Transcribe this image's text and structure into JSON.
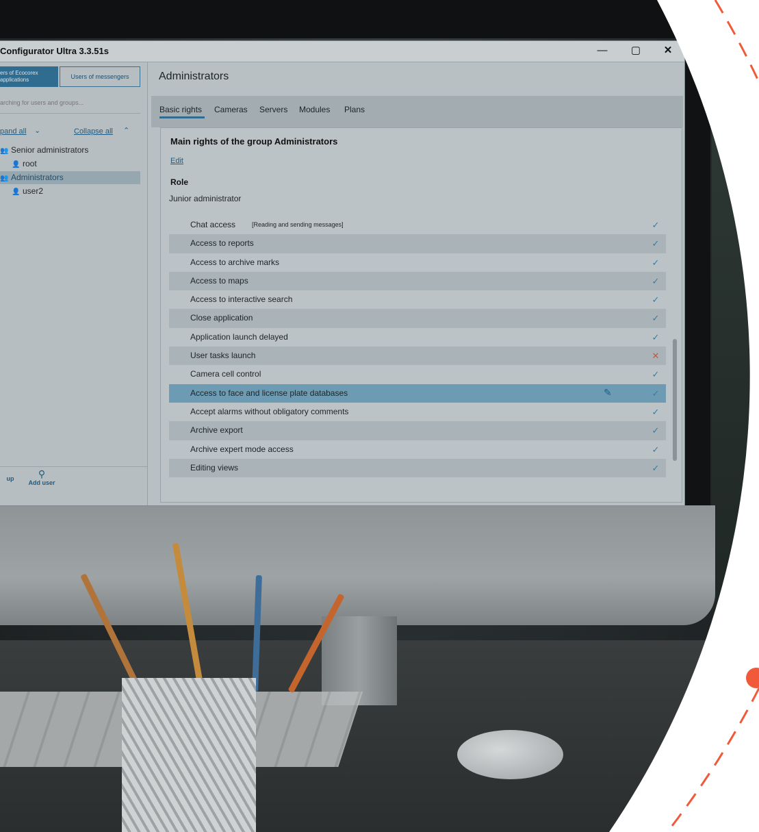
{
  "window": {
    "title": "Configurator Ultra 3.3.51s",
    "minimize_icon": "minimize-icon",
    "maximize_icon": "maximize-icon",
    "close_icon": "close-icon"
  },
  "sidebar": {
    "tabs": {
      "apps_label": "ers of Ecocorex\napplications",
      "messengers_label": "Users of messengers"
    },
    "search_placeholder": "arching for users and groups...",
    "expand_all": "pand all",
    "collapse_all": "Collapse all",
    "tree": [
      {
        "label": "Senior administrators",
        "icon": "group-icon"
      },
      {
        "label": "root",
        "icon": "user-icon"
      },
      {
        "label": "Administrators",
        "icon": "group-icon",
        "selected": true
      },
      {
        "label": "user2",
        "icon": "user-icon"
      }
    ],
    "footer": {
      "add_group": "up",
      "add_user": "Add user"
    }
  },
  "main": {
    "title": "Administrators",
    "tabs": [
      "Basic rights",
      "Cameras",
      "Servers",
      "Modules",
      "Plans"
    ],
    "active_tab": "Basic rights",
    "section_title": "Main rights of the group Administrators",
    "edit_link": "Edit",
    "role_label": "Role",
    "role_value": "Junior administrator",
    "rights": [
      {
        "name": "Chat access",
        "note": "[Reading and sending messages]",
        "status": "allowed"
      },
      {
        "name": "Access to reports",
        "status": "allowed"
      },
      {
        "name": "Access to archive marks",
        "status": "allowed"
      },
      {
        "name": "Access to maps",
        "status": "allowed"
      },
      {
        "name": "Access to interactive search",
        "status": "allowed"
      },
      {
        "name": "Close application",
        "status": "allowed"
      },
      {
        "name": "Application launch delayed",
        "status": "allowed"
      },
      {
        "name": "User tasks launch",
        "status": "denied"
      },
      {
        "name": "Camera cell control",
        "status": "allowed"
      },
      {
        "name": "Access to face and license plate databases",
        "status": "allowed",
        "selected": true
      },
      {
        "name": "Accept alarms without obligatory comments",
        "status": "allowed"
      },
      {
        "name": "Archive export",
        "status": "allowed"
      },
      {
        "name": "Archive expert mode access",
        "status": "allowed"
      },
      {
        "name": "Editing views",
        "status": "allowed"
      }
    ],
    "status_glyphs": {
      "allowed": "✓",
      "denied": "✕"
    }
  },
  "colors": {
    "accent": "#2f6c8f",
    "decor_orange": "#f0593a"
  }
}
